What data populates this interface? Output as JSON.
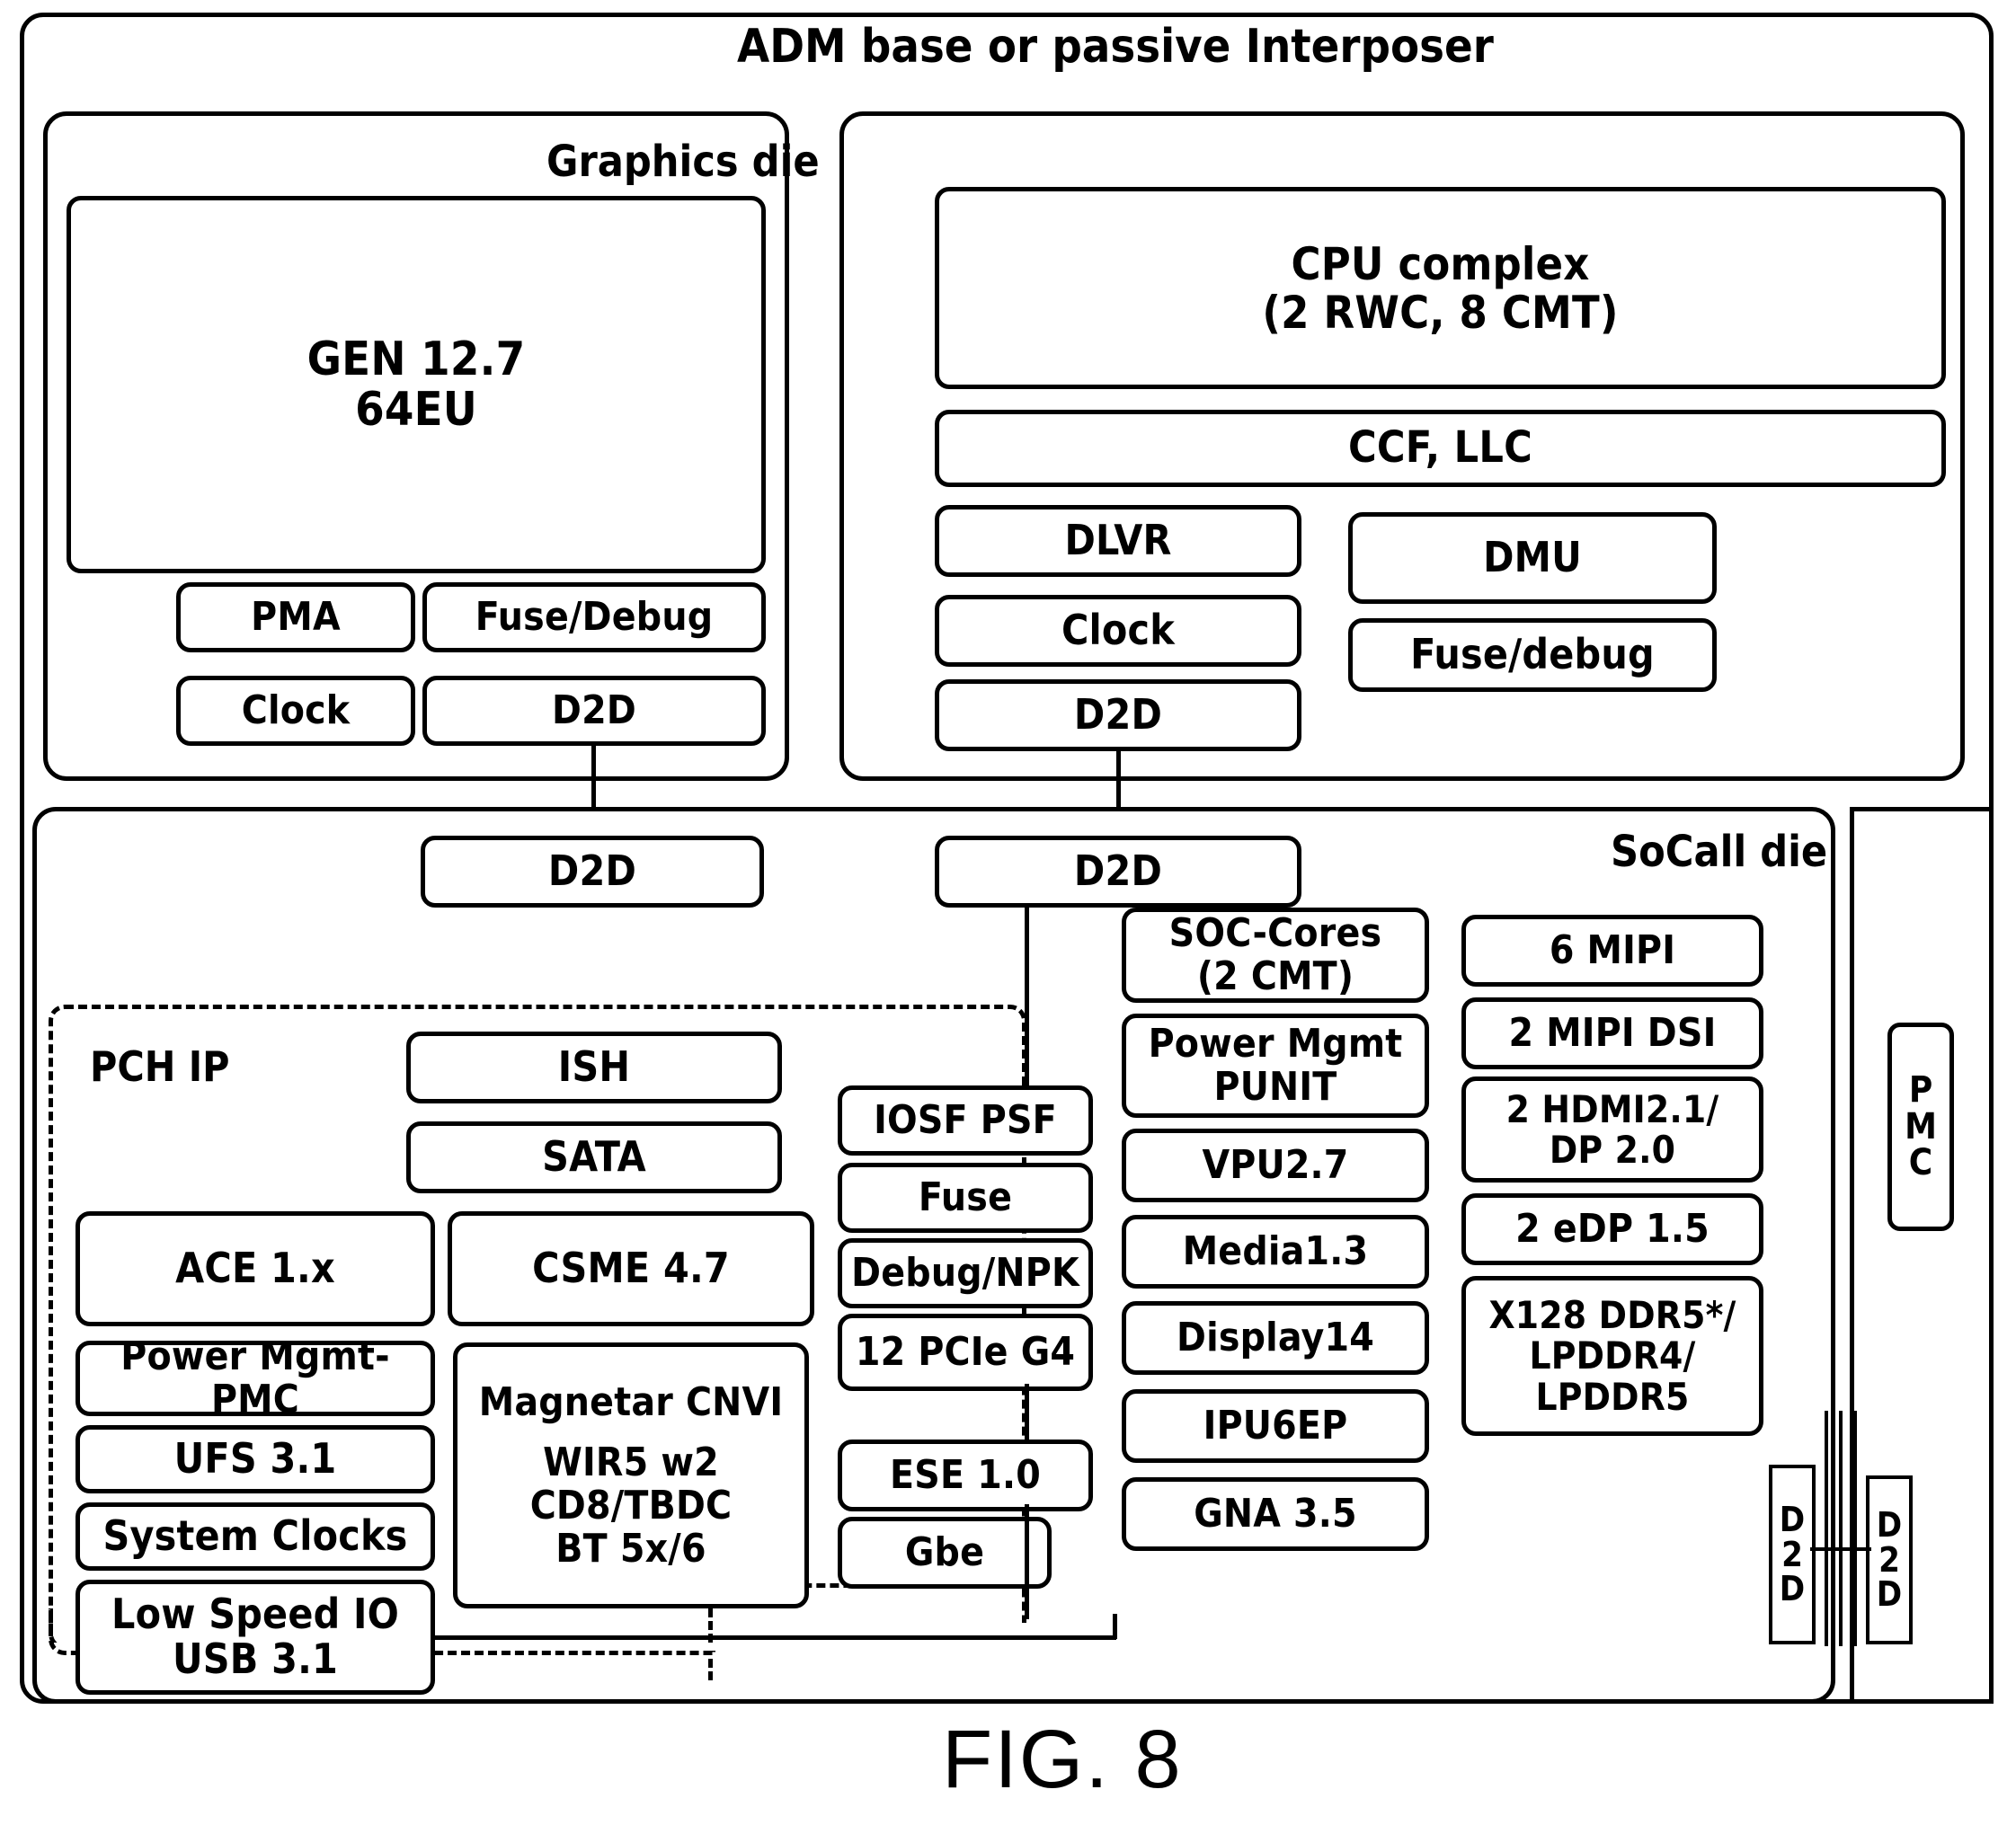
{
  "figure": {
    "caption": "FIG. 8"
  },
  "interposer": {
    "title": "ADM base or passive Interposer"
  },
  "graphics_die": {
    "title": "Graphics die",
    "main": {
      "line1": "GEN 12.7",
      "line2": "64EU"
    },
    "blocks": [
      {
        "label": "PMA"
      },
      {
        "label": "Fuse/Debug"
      },
      {
        "label": "Clock"
      },
      {
        "label": "D2D"
      }
    ]
  },
  "cpu_die": {
    "cpu_complex": {
      "line1": "CPU complex",
      "line2": "(2 RWC, 8 CMT)"
    },
    "ccf_llc": "CCF, LLC",
    "blocks_left": [
      {
        "label": "DLVR"
      },
      {
        "label": "Clock"
      },
      {
        "label": "D2D"
      }
    ],
    "blocks_right": [
      {
        "label": "DMU"
      },
      {
        "label": "Fuse/debug"
      }
    ]
  },
  "socall_die": {
    "title": "SoCall die",
    "d2d_graphics": "D2D",
    "d2d_cpu": "D2D",
    "pch_ip": {
      "title": "PCH IP",
      "top_right": [
        {
          "label": "ISH"
        },
        {
          "label": "SATA"
        }
      ],
      "left_column": [
        {
          "label": "ACE 1.x"
        },
        {
          "label": "Power Mgmt-PMC"
        },
        {
          "label": "UFS 3.1"
        },
        {
          "label": "System Clocks"
        },
        {
          "label": "Low Speed IO\nUSB 3.1",
          "line1": "Low Speed IO",
          "line2": "USB 3.1"
        }
      ],
      "right_column": [
        {
          "label": "CSME 4.7"
        },
        {
          "label": "Magnetar CNVI",
          "line1": "Magnetar CNVI",
          "line2": "WIR5 w2",
          "line3": "CD8/TBDC",
          "line4": "BT 5x/6"
        }
      ]
    },
    "fabric_column": [
      {
        "label": "IOSF PSF"
      },
      {
        "label": "Fuse"
      },
      {
        "label": "Debug/NPK"
      },
      {
        "label": "12 PCIe G4"
      },
      {
        "label": "ESE 1.0"
      },
      {
        "label": "Gbe"
      }
    ],
    "soc_column": [
      {
        "label": "SOC-Cores (2 CMT)",
        "line1": "SOC-Cores",
        "line2": "(2 CMT)"
      },
      {
        "label": "Power Mgmt PUNIT",
        "line1": "Power Mgmt",
        "line2": "PUNIT"
      },
      {
        "label": "VPU2.7"
      },
      {
        "label": "Media1.3"
      },
      {
        "label": "Display14"
      },
      {
        "label": "IPU6EP"
      },
      {
        "label": "GNA 3.5"
      }
    ],
    "io_column": [
      {
        "label": "6 MIPI"
      },
      {
        "label": "2 MIPI DSI"
      },
      {
        "label": "2 HDMI2.1/ DP 2.0",
        "line1": "2 HDMI2.1/",
        "line2": "DP 2.0"
      },
      {
        "label": "2 eDP 1.5"
      },
      {
        "label": "X128 DDR5*/ LPDDR4/ LPDDR5",
        "line1": "X128 DDR5*/",
        "line2": "LPDDR4/",
        "line3": "LPDDR5"
      }
    ]
  },
  "side_panel": {
    "pmc": {
      "label": "PMC",
      "letters": [
        "P",
        "M",
        "C"
      ]
    },
    "d2d_left": {
      "label": "D2D",
      "letters": [
        "D",
        "2",
        "D"
      ]
    },
    "d2d_right": {
      "label": "D2D",
      "letters": [
        "D",
        "2",
        "D"
      ]
    }
  },
  "colors": {
    "line": "#000000",
    "background": "#ffffff"
  }
}
